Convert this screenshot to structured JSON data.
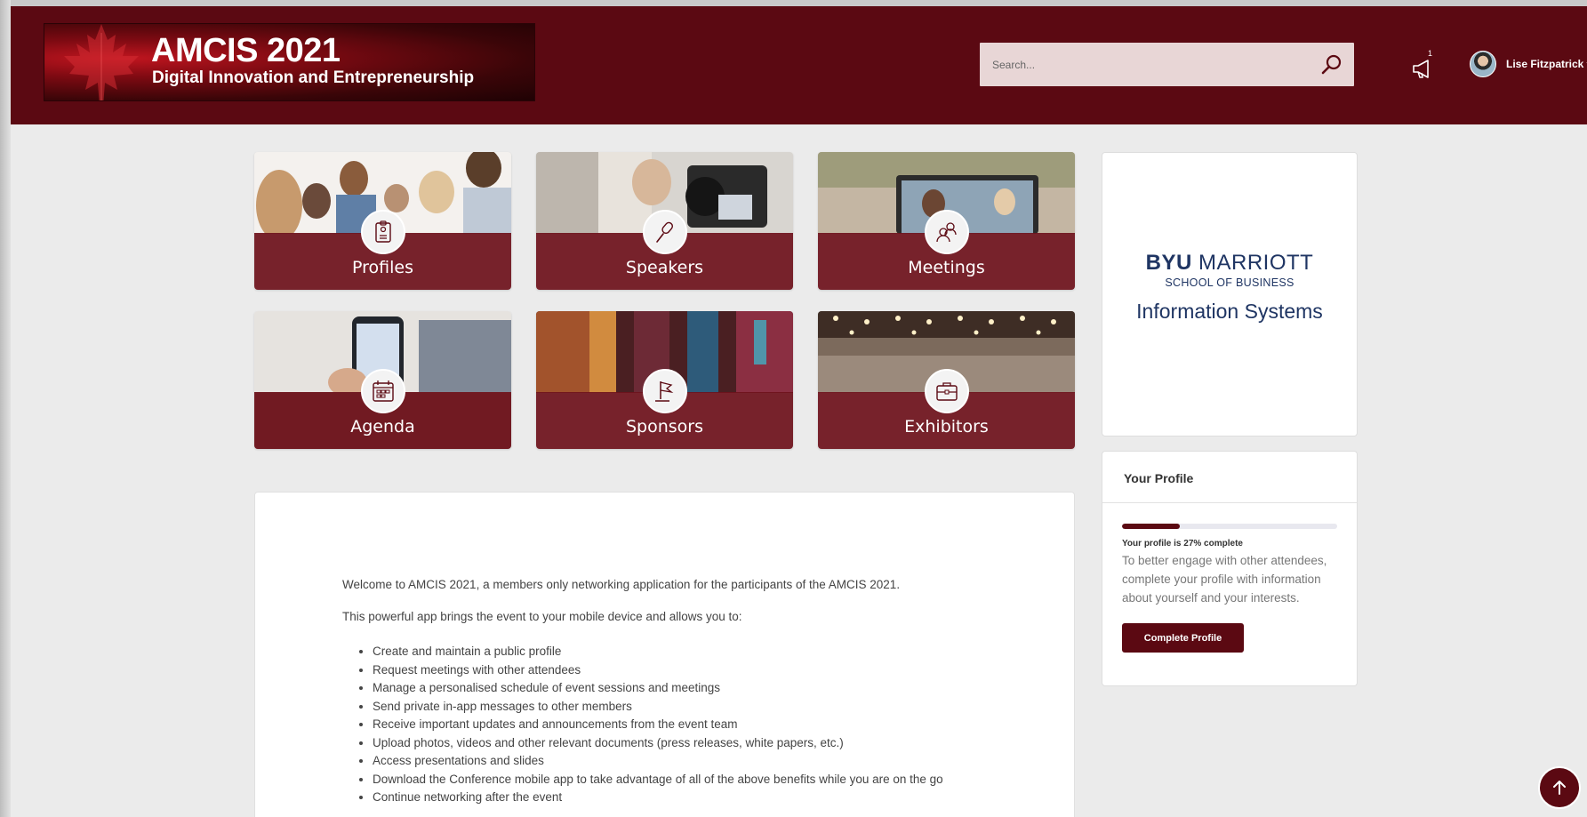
{
  "header": {
    "banner_title": "AMCIS 2021",
    "banner_subtitle": "Digital Innovation and Entrepreneurship",
    "search_placeholder": "Search...",
    "announcement_count": "1",
    "user_name": "Lise Fitzpatrick"
  },
  "tiles": [
    {
      "label": "Profiles",
      "icon": "profile-badge-icon"
    },
    {
      "label": "Speakers",
      "icon": "microphone-icon"
    },
    {
      "label": "Meetings",
      "icon": "people-icon"
    },
    {
      "label": "Agenda",
      "icon": "calendar-icon"
    },
    {
      "label": "Sponsors",
      "icon": "flag-icon"
    },
    {
      "label": "Exhibitors",
      "icon": "briefcase-icon"
    }
  ],
  "sponsor": {
    "logo_byu": "BYU",
    "logo_marriott": "MARRIOTT",
    "logo_school": "SCHOOL OF BUSINESS",
    "logo_department": "Information Systems"
  },
  "profile": {
    "title": "Your Profile",
    "progress_percent": 27,
    "progress_text": "Your profile is 27% complete",
    "description": "To better engage with other attendees, complete your profile with information about yourself and your interests.",
    "button_label": "Complete Profile"
  },
  "welcome": {
    "intro": "Welcome to AMCIS 2021, a members only networking application for the participants of the AMCIS 2021.",
    "paragraph2": "This powerful app brings the event to your mobile device and allows you to:",
    "benefits": [
      "Create and maintain a public profile",
      "Request meetings with other attendees",
      "Manage a personalised schedule of event sessions and meetings",
      "Send private in-app messages to other members",
      "Receive important updates and announcements from the event team",
      "Upload photos, videos and other relevant documents (press releases, white papers, etc.)",
      "Access presentations and slides",
      "Download the Conference mobile app to take advantage of all of the above benefits while you are on the go",
      "Continue networking after the event"
    ]
  },
  "colors": {
    "brand": "#5b0912",
    "tile_overlay": "#6e121c",
    "sponsor_text": "#1f3563"
  }
}
